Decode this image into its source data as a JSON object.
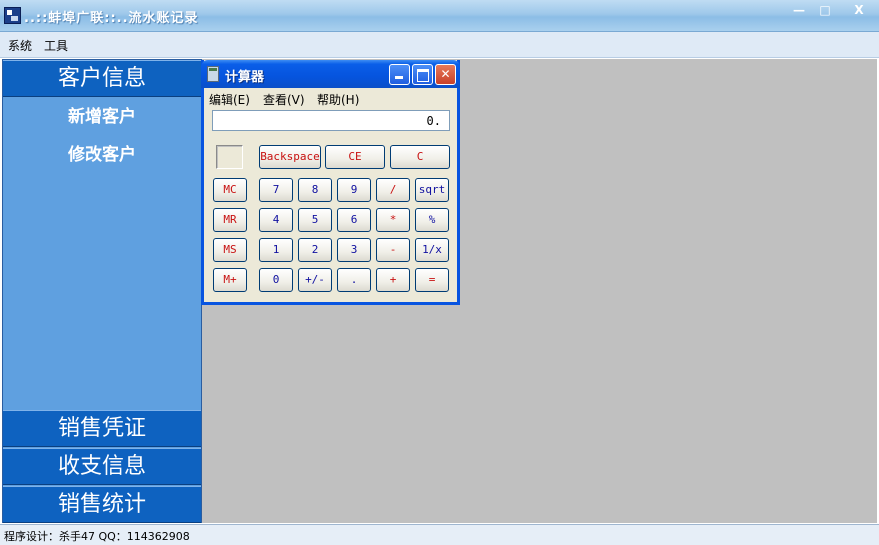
{
  "window": {
    "title": "..::蚌埠广联::..流水账记录",
    "min_glyph": "—",
    "max_glyph": "□",
    "close_glyph": "X"
  },
  "menubar": {
    "items": [
      "系统",
      "工具"
    ]
  },
  "sidebar": {
    "headers": [
      "客户信息",
      "销售凭证",
      "收支信息",
      "销售统计"
    ],
    "sub_items": [
      "新增客户",
      "修改客户"
    ]
  },
  "calculator": {
    "title": "计算器",
    "menu": [
      "编辑(E)",
      "查看(V)",
      "帮助(H)"
    ],
    "display": "0.",
    "close_glyph": "✕",
    "top_buttons": [
      "Backspace",
      "CE",
      "C"
    ],
    "memory_buttons": [
      "MC",
      "MR",
      "MS",
      "M+"
    ],
    "rows": [
      [
        "7",
        "8",
        "9",
        "/",
        "sqrt"
      ],
      [
        "4",
        "5",
        "6",
        "*",
        "%"
      ],
      [
        "1",
        "2",
        "3",
        "-",
        "1/x"
      ],
      [
        "0",
        "+/-",
        ".",
        "+",
        "="
      ]
    ]
  },
  "statusbar": {
    "text": "程序设计：杀手47 QQ：114362908"
  },
  "colors": {
    "sidebar_header": "#0e62c0",
    "sidebar_bg": "#5fa0e0",
    "workspace": "#c0c0c0",
    "calc_titlebar": "#0654de",
    "calc_red_text": "#c81010",
    "calc_blue_text": "#1010a0"
  }
}
